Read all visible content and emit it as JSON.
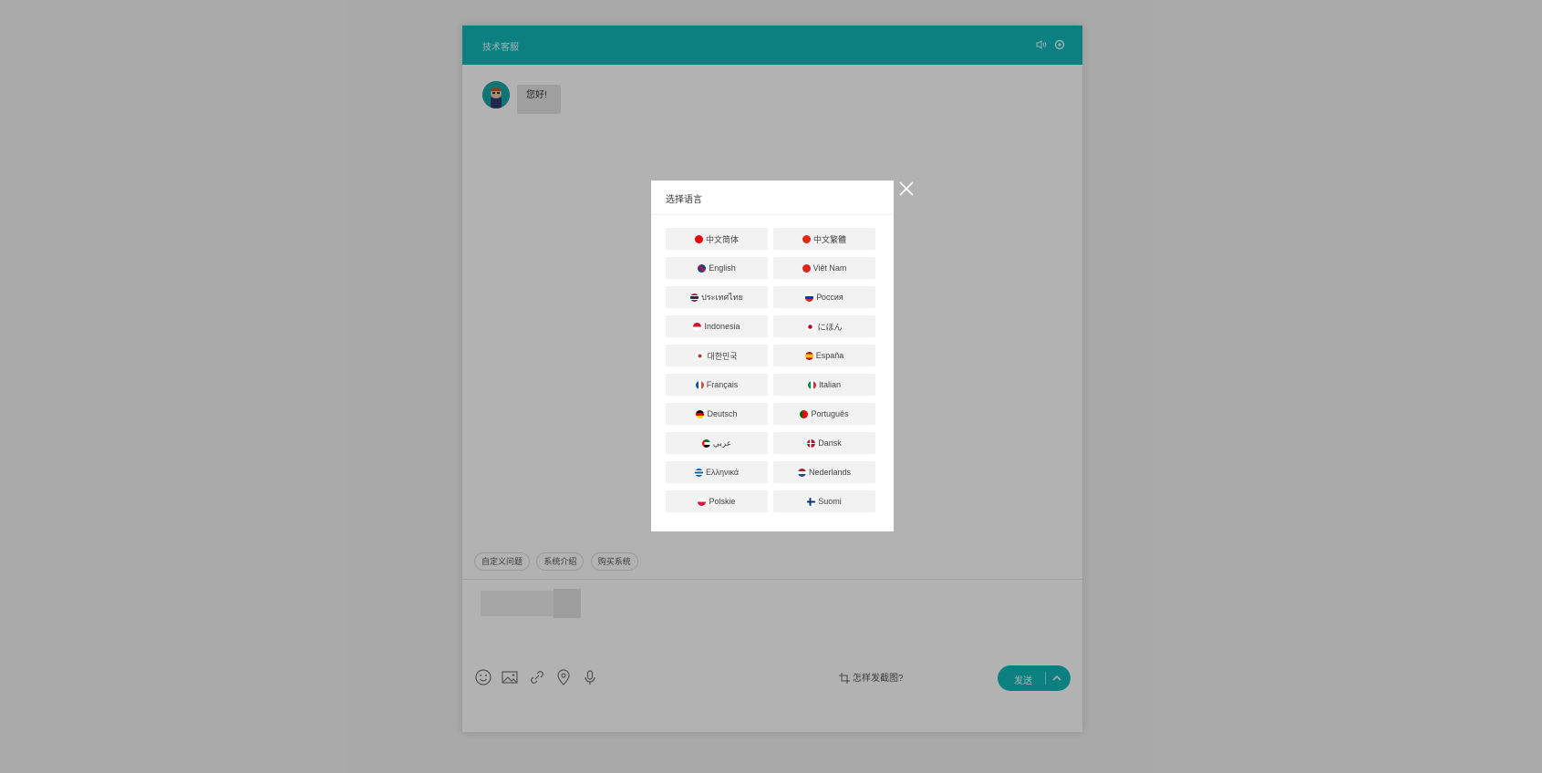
{
  "chat": {
    "title": "技术客服",
    "greeting": "您好!",
    "quick_questions": [
      "自定义问题",
      "系统介绍",
      "购买系统"
    ],
    "howto_label": "怎样发截图?",
    "send_label": "发送"
  },
  "modal": {
    "title": "选择语言",
    "languages": [
      {
        "label": "中文简体",
        "flag": "cn"
      },
      {
        "label": "中文繁體",
        "flag": "hk"
      },
      {
        "label": "English",
        "flag": "gb"
      },
      {
        "label": "Việt Nam",
        "flag": "vn"
      },
      {
        "label": "ประเทศไทย",
        "flag": "th"
      },
      {
        "label": "Россия",
        "flag": "ru"
      },
      {
        "label": "Indonesia",
        "flag": "id"
      },
      {
        "label": "にほん",
        "flag": "jp"
      },
      {
        "label": "대한민국",
        "flag": "kr"
      },
      {
        "label": "España",
        "flag": "es"
      },
      {
        "label": "Français",
        "flag": "fr"
      },
      {
        "label": "Italian",
        "flag": "it"
      },
      {
        "label": "Deutsch",
        "flag": "de"
      },
      {
        "label": "Português",
        "flag": "pt"
      },
      {
        "label": "عربي",
        "flag": "ae"
      },
      {
        "label": "Dansk",
        "flag": "dk"
      },
      {
        "label": "Ελληνικά",
        "flag": "gr"
      },
      {
        "label": "Nederlands",
        "flag": "nl"
      },
      {
        "label": "Polskie",
        "flag": "pl"
      },
      {
        "label": "Suomi",
        "flag": "fi"
      }
    ]
  },
  "colors": {
    "accent": "#12b6b8",
    "overlay": "rgba(0,0,0,0.3)"
  },
  "icons": {
    "header": [
      "speaker-icon",
      "settings-icon"
    ],
    "toolbar": [
      "emoji-icon",
      "image-icon",
      "link-icon",
      "location-icon",
      "microphone-icon"
    ],
    "screenshot": "crop-icon",
    "send_dropdown": "chevron-up-icon",
    "close": "close-icon"
  }
}
